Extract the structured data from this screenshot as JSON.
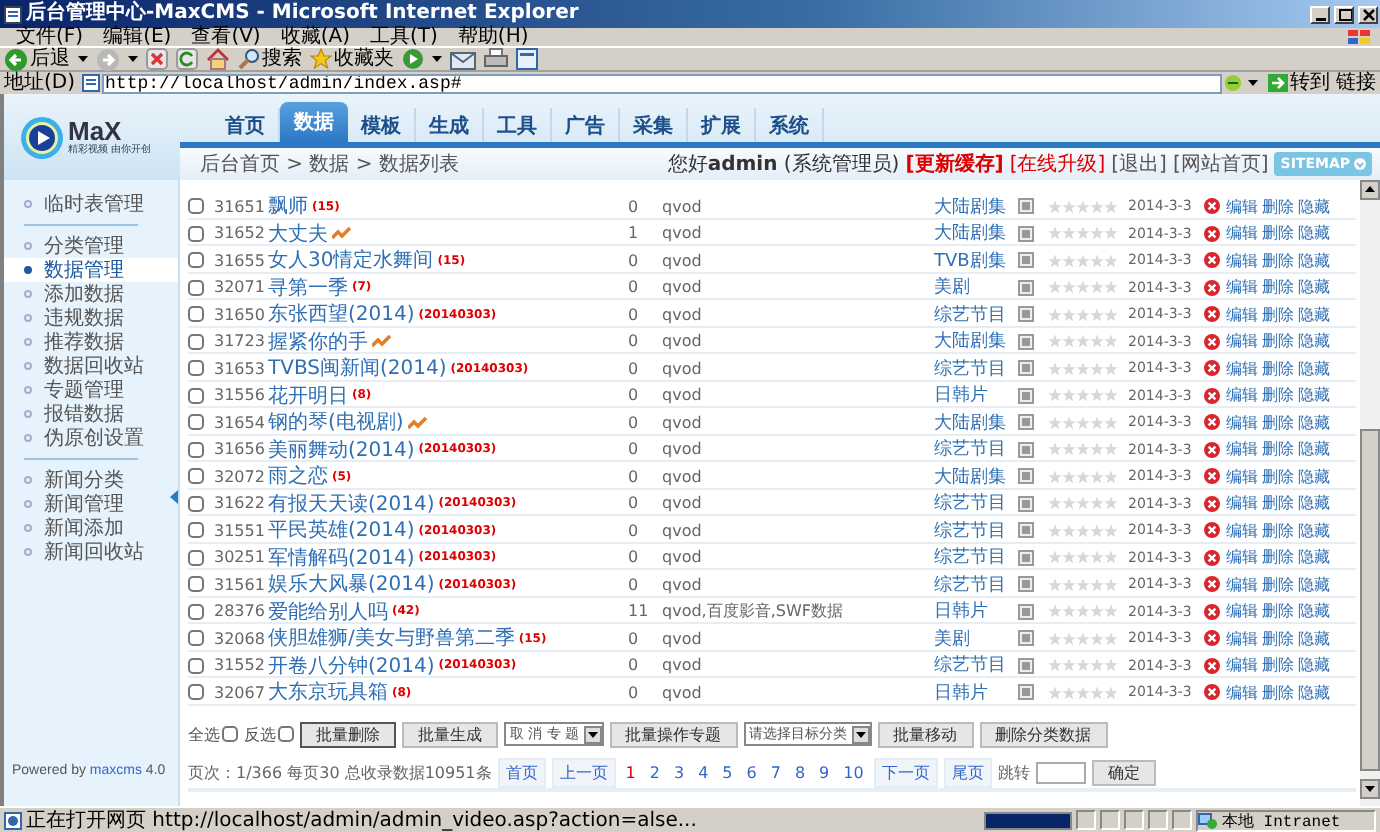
{
  "window": {
    "title": "后台管理中心-MaxCMS - Microsoft Internet Explorer"
  },
  "menu_bar": [
    "文件(F)",
    "编辑(E)",
    "查看(V)",
    "收藏(A)",
    "工具(T)",
    "帮助(H)"
  ],
  "toolbar": [
    {
      "kind": "back",
      "label": "后退"
    },
    {
      "kind": "forward"
    },
    {
      "kind": "stop"
    },
    {
      "kind": "refresh"
    },
    {
      "kind": "home"
    },
    {
      "kind": "search",
      "label": "搜索"
    },
    {
      "kind": "favorites",
      "label": "收藏夹"
    },
    {
      "kind": "media"
    },
    {
      "kind": "mail"
    },
    {
      "kind": "print"
    },
    {
      "kind": "edit"
    }
  ],
  "address_bar": {
    "label": "地址(D)",
    "value": "http://localhost/admin/index.asp#",
    "go": "转到",
    "links": "链接"
  },
  "header": {
    "logo_text": "MaX",
    "logo_slogan": "精彩视频 由你开创"
  },
  "nav_tabs": [
    {
      "label": "首页",
      "selected": false
    },
    {
      "label": "数据",
      "selected": true
    },
    {
      "label": "模板",
      "selected": false
    },
    {
      "label": "生成",
      "selected": false
    },
    {
      "label": "工具",
      "selected": false
    },
    {
      "label": "广告",
      "selected": false
    },
    {
      "label": "采集",
      "selected": false
    },
    {
      "label": "扩展",
      "selected": false
    },
    {
      "label": "系统",
      "selected": false
    }
  ],
  "breadcrumb": "后台首页 > 数据 > 数据列表",
  "user_bar": {
    "greeting": "您好**admin** (系统管理员)",
    "links": [
      {
        "label": "[更新缓存]",
        "kind": "primary"
      },
      {
        "label": "[在线升级]",
        "kind": "warning"
      },
      {
        "label": "[退出]",
        "kind": "normal"
      },
      {
        "label": "[网站首页]",
        "kind": "normal"
      }
    ],
    "sitemap": "SITEMAP"
  },
  "sidebar": {
    "groups": [
      [
        {
          "label": "临时表管理",
          "selected": false
        }
      ],
      [
        {
          "label": "分类管理",
          "selected": false
        },
        {
          "label": "数据管理",
          "selected": true
        },
        {
          "label": "添加数据",
          "selected": false
        },
        {
          "label": "违规数据",
          "selected": false
        },
        {
          "label": "推荐数据",
          "selected": false
        },
        {
          "label": "数据回收站",
          "selected": false
        },
        {
          "label": "专题管理",
          "selected": false
        },
        {
          "label": "报错数据",
          "selected": false
        },
        {
          "label": "伪原创设置",
          "selected": false
        }
      ],
      [
        {
          "label": "新闻分类",
          "selected": false
        },
        {
          "label": "新闻管理",
          "selected": false
        },
        {
          "label": "新闻添加",
          "selected": false
        },
        {
          "label": "新闻回收站",
          "selected": false
        }
      ]
    ],
    "footer": {
      "text": "Powered by",
      "link": "maxcms",
      "version": "4.0"
    }
  },
  "table": {
    "rows": [
      {
        "checked": false,
        "id": "31651",
        "title": "飘师",
        "badge": "(15)",
        "hot": false,
        "hits": "0",
        "player": "qvod",
        "category": "大陆剧集",
        "stars": 0,
        "date": "2014-3-3",
        "actions": [
          "编辑",
          "删除",
          "隐藏"
        ]
      },
      {
        "checked": false,
        "id": "31652",
        "title": "大丈夫",
        "hot": true,
        "hits": "1",
        "player": "qvod",
        "category": "大陆剧集",
        "stars": 0,
        "date": "2014-3-3",
        "actions": [
          "编辑",
          "删除",
          "隐藏"
        ]
      },
      {
        "checked": false,
        "id": "31655",
        "title": "女人30情定水舞间",
        "badge": "(15)",
        "hot": false,
        "hits": "0",
        "player": "qvod",
        "category": "TVB剧集",
        "stars": 0,
        "date": "2014-3-3",
        "actions": [
          "编辑",
          "删除",
          "隐藏"
        ]
      },
      {
        "checked": false,
        "id": "32071",
        "title": "寻第一季",
        "badge": "(7)",
        "hot": false,
        "hits": "0",
        "player": "qvod",
        "category": "美剧",
        "stars": 0,
        "date": "2014-3-3",
        "actions": [
          "编辑",
          "删除",
          "隐藏"
        ]
      },
      {
        "checked": false,
        "id": "31650",
        "title": "东张西望(2014)",
        "badge": "(20140303)",
        "hot": false,
        "hits": "0",
        "player": "qvod",
        "category": "综艺节目",
        "stars": 0,
        "date": "2014-3-3",
        "actions": [
          "编辑",
          "删除",
          "隐藏"
        ]
      },
      {
        "checked": false,
        "id": "31723",
        "title": "握紧你的手",
        "hot": true,
        "hits": "0",
        "player": "qvod",
        "category": "大陆剧集",
        "stars": 0,
        "date": "2014-3-3",
        "actions": [
          "编辑",
          "删除",
          "隐藏"
        ]
      },
      {
        "checked": false,
        "id": "31653",
        "title": "TVBS闽新闻(2014)",
        "badge": "(20140303)",
        "hot": false,
        "hits": "0",
        "player": "qvod",
        "category": "综艺节目",
        "stars": 0,
        "date": "2014-3-3",
        "actions": [
          "编辑",
          "删除",
          "隐藏"
        ]
      },
      {
        "checked": false,
        "id": "31556",
        "title": "花开明日",
        "badge": "(8)",
        "hot": false,
        "hits": "0",
        "player": "qvod",
        "category": "日韩片",
        "stars": 0,
        "date": "2014-3-3",
        "actions": [
          "编辑",
          "删除",
          "隐藏"
        ]
      },
      {
        "checked": false,
        "id": "31654",
        "title": "钢的琴(电视剧)",
        "hot": true,
        "hits": "0",
        "player": "qvod",
        "category": "大陆剧集",
        "stars": 0,
        "date": "2014-3-3",
        "actions": [
          "编辑",
          "删除",
          "隐藏"
        ]
      },
      {
        "checked": false,
        "id": "31656",
        "title": "美丽舞动(2014)",
        "badge": "(20140303)",
        "hot": false,
        "hits": "0",
        "player": "qvod",
        "category": "综艺节目",
        "stars": 0,
        "date": "2014-3-3",
        "actions": [
          "编辑",
          "删除",
          "隐藏"
        ]
      },
      {
        "checked": false,
        "id": "32072",
        "title": "雨之恋",
        "badge": "(5)",
        "hot": false,
        "hits": "0",
        "player": "qvod",
        "category": "大陆剧集",
        "stars": 0,
        "date": "2014-3-3",
        "actions": [
          "编辑",
          "删除",
          "隐藏"
        ]
      },
      {
        "checked": false,
        "id": "31622",
        "title": "有报天天读(2014)",
        "badge": "(20140303)",
        "hot": false,
        "hits": "0",
        "player": "qvod",
        "category": "综艺节目",
        "stars": 0,
        "date": "2014-3-3",
        "actions": [
          "编辑",
          "删除",
          "隐藏"
        ]
      },
      {
        "checked": false,
        "id": "31551",
        "title": "平民英雄(2014)",
        "badge": "(20140303)",
        "hot": false,
        "hits": "0",
        "player": "qvod",
        "category": "综艺节目",
        "stars": 0,
        "date": "2014-3-3",
        "actions": [
          "编辑",
          "删除",
          "隐藏"
        ]
      },
      {
        "checked": false,
        "id": "30251",
        "title": "军情解码(2014)",
        "badge": "(20140303)",
        "hot": false,
        "hits": "0",
        "player": "qvod",
        "category": "综艺节目",
        "stars": 0,
        "date": "2014-3-3",
        "actions": [
          "编辑",
          "删除",
          "隐藏"
        ]
      },
      {
        "checked": false,
        "id": "31561",
        "title": "娱乐大风暴(2014)",
        "badge": "(20140303)",
        "hot": false,
        "hits": "0",
        "player": "qvod",
        "category": "综艺节目",
        "stars": 0,
        "date": "2014-3-3",
        "actions": [
          "编辑",
          "删除",
          "隐藏"
        ]
      },
      {
        "checked": false,
        "id": "28376",
        "title": "爱能给别人吗",
        "badge": "(42)",
        "hot": false,
        "hits": "11",
        "player": "qvod,百度影音,SWF数据",
        "category": "日韩片",
        "stars": 0,
        "date": "2014-3-3",
        "actions": [
          "编辑",
          "删除",
          "隐藏"
        ]
      },
      {
        "checked": false,
        "id": "32068",
        "title": "侠胆雄狮/美女与野兽第二季",
        "badge": "(15)",
        "hot": false,
        "hits": "0",
        "player": "qvod",
        "category": "美剧",
        "stars": 0,
        "date": "2014-3-3",
        "actions": [
          "编辑",
          "删除",
          "隐藏"
        ]
      },
      {
        "checked": false,
        "id": "31552",
        "title": "开卷八分钟(2014)",
        "badge": "(20140303)",
        "hot": false,
        "hits": "0",
        "player": "qvod",
        "category": "综艺节目",
        "stars": 0,
        "date": "2014-3-3",
        "actions": [
          "编辑",
          "删除",
          "隐藏"
        ]
      },
      {
        "checked": false,
        "id": "32067",
        "title": "大东京玩具箱",
        "badge": "(8)",
        "hot": false,
        "hits": "0",
        "player": "qvod",
        "category": "日韩片",
        "stars": 0,
        "date": "2014-3-3",
        "actions": [
          "编辑",
          "删除",
          "隐藏"
        ]
      }
    ]
  },
  "batch_bar": {
    "select_all": {
      "label": "全选",
      "checked": false
    },
    "invert": {
      "label": "反选",
      "checked": false
    },
    "controls": [
      {
        "kind": "button",
        "label": "批量删除"
      },
      {
        "kind": "button",
        "label": "批量生成"
      },
      {
        "kind": "select",
        "label": "取 消 专 题"
      },
      {
        "kind": "button",
        "label": "批量操作专题"
      },
      {
        "kind": "select",
        "label": "请选择目标分类"
      },
      {
        "kind": "button",
        "label": "批量移动"
      },
      {
        "kind": "button",
        "label": "删除分类数据"
      }
    ]
  },
  "pagination": {
    "info": "页次：1/366 每页30 总收录数据10951条",
    "first": "首页",
    "prev": "上一页",
    "pages": [
      {
        "label": "1",
        "selected": true
      },
      {
        "label": "2",
        "selected": false
      },
      {
        "label": "3",
        "selected": false
      },
      {
        "label": "4",
        "selected": false
      },
      {
        "label": "5",
        "selected": false
      },
      {
        "label": "6",
        "selected": false
      },
      {
        "label": "7",
        "selected": false
      },
      {
        "label": "8",
        "selected": false
      },
      {
        "label": "9",
        "selected": false
      },
      {
        "label": "10",
        "selected": false
      }
    ],
    "next": "下一页",
    "last": "尾页",
    "jump_label": "跳转",
    "confirm": "确定"
  },
  "status_bar": {
    "text": "正在打开网页 http://localhost/admin/admin_video.asp?action=alse...",
    "progress": {
      "level": 1
    },
    "zone": "本地 Intranet"
  }
}
